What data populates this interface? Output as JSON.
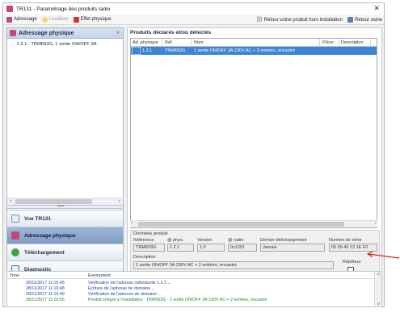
{
  "window": {
    "title": "TR131 - Paramétrage des produits radio",
    "close_glyph": "✕"
  },
  "toolbar": {
    "adressage": "Adressage",
    "localiser": "Localiser",
    "effet_physique": "Effet physique",
    "retour_usine_hors": "Retour usine produit hors installation",
    "retour_usine": "Retour usine"
  },
  "left_panel": {
    "header": "Adressage physique",
    "collapse_glyph": "«",
    "tree_items": [
      "1.2.1 - TRM693G, 1 sortie ON/OFF 3A"
    ],
    "nav": {
      "vue_tr131": "Vue TR131",
      "adressage_physique": "Adressage physique",
      "telechargement": "Téléchargement",
      "diagnostic": "Diagnostic"
    }
  },
  "products": {
    "title": "Produits déclarés et/ou détectés",
    "columns": {
      "ad_physique": "Ad. physique",
      "ref": "Réf.",
      "nom": "Nom",
      "piece": "Pièce",
      "description": "Description"
    },
    "rows": [
      {
        "ad_physique": "1.2.1",
        "ref": "TRM693G",
        "nom": "1 sortie ON/OFF 3A 230V AC + 2 entrées, encastré",
        "piece": "",
        "description": ""
      }
    ]
  },
  "details": {
    "title": "Données produit",
    "labels": {
      "reference": "Référence",
      "phys": "@ phys.",
      "version": "Version",
      "radio": "@ radio",
      "dernier_telechargement": "Dernier téléchargement",
      "numero_serie": "Numéro de série",
      "description": "Description",
      "repeteur": "Répéteur"
    },
    "values": {
      "reference": "TRM693G",
      "phys": "1.2.1",
      "version": "1.0",
      "radio": "0x1201",
      "dernier_telechargement": "Jamais",
      "numero_serie": "00 09 40 13 1E F0",
      "description": "1 sortie ON/OFF 3A 230V AC + 2 entrées, encastré"
    },
    "repeteur_checked": false
  },
  "log": {
    "columns": {
      "time": "Time",
      "event": "Evenement"
    },
    "rows": [
      {
        "time": "28/11/2017 11:16:45",
        "event": "Vérification de l'adresse individuelle 1.2.1 ...",
        "color": "#2b3fa8"
      },
      {
        "time": "28/11/2017 11:16:48",
        "event": "Ecriture de l'adresse de domaine ...",
        "color": "#2b3fa8"
      },
      {
        "time": "28/11/2017 11:16:49",
        "event": "Vérification de l'adresse de domaine ...",
        "color": "#2b3fa8"
      },
      {
        "time": "28/11/2017 11:16:55",
        "event": "Produit intégré à l'installation : TRM693G - 1 sortie ON/OFF 3A 230V AC + 2 entrées, encastré",
        "color": "#1f8a2a"
      }
    ]
  },
  "colors": {
    "accent_magenta": "#c6467a",
    "selection_blue": "#3d86d6",
    "annotation_red": "#d9261c"
  }
}
